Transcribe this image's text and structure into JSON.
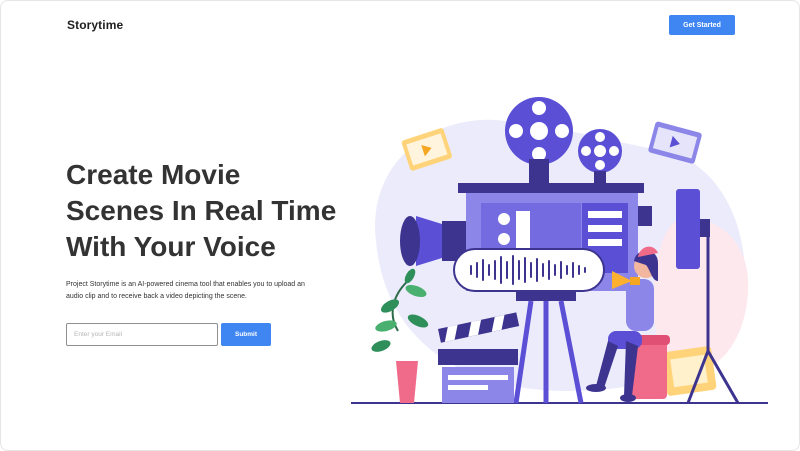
{
  "header": {
    "brand": "Storytime",
    "cta_label": "Get Started"
  },
  "hero": {
    "headline_lines": [
      "Create Movie",
      "Scenes In Real Time",
      "With Your Voice"
    ],
    "description_line1": "Project Storytime is an AI-powered cinema tool that enables you to upload an",
    "description_line2": "audio clip and to receive back a video depicting the scene."
  },
  "form": {
    "email_placeholder": "Enter your Email",
    "submit_label": "Submit"
  },
  "colors": {
    "accent": "#3f86f3",
    "illustration_primary": "#5b4fd6",
    "illustration_light": "#8b86e8"
  },
  "illustration": {
    "icon": "movie-projector-illustration"
  }
}
